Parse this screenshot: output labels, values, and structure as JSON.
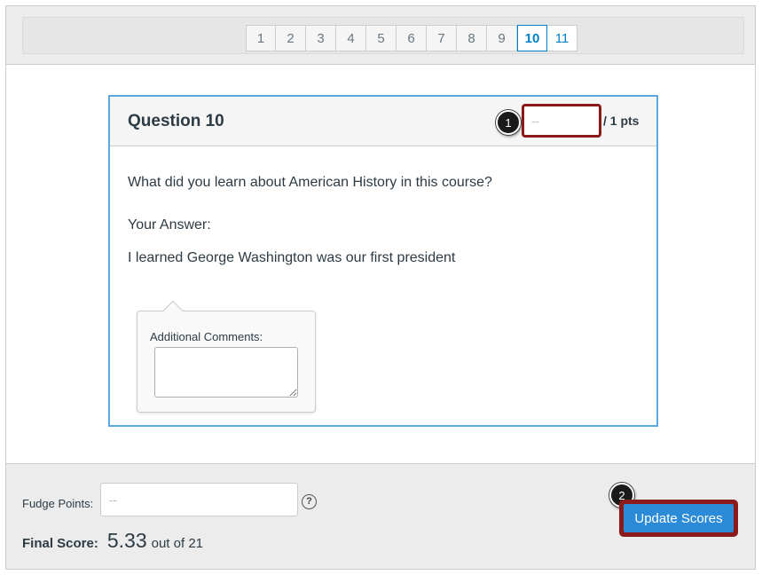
{
  "pagination": {
    "pages": [
      "1",
      "2",
      "3",
      "4",
      "5",
      "6",
      "7",
      "8",
      "9",
      "10",
      "11"
    ],
    "active": "10"
  },
  "question": {
    "title": "Question 10",
    "points_placeholder": "--",
    "points_suffix": "/ 1 pts",
    "prompt": "What did you learn about American History in this course?",
    "answer_label": "Your Answer:",
    "answer": "I learned George Washington was our first president",
    "comments_label": "Additional Comments:"
  },
  "callouts": {
    "first": "1",
    "second": "2"
  },
  "footer": {
    "fudge_label": "Fudge Points:",
    "fudge_placeholder": "--",
    "help_icon": "?",
    "final_label": "Final Score:",
    "final_score": "5.33",
    "final_out_of": "out of 21",
    "update_button": "Update Scores"
  },
  "colors": {
    "accent": "#0081c6",
    "button": "#2b8bd8",
    "highlight": "#8b1a1a"
  }
}
